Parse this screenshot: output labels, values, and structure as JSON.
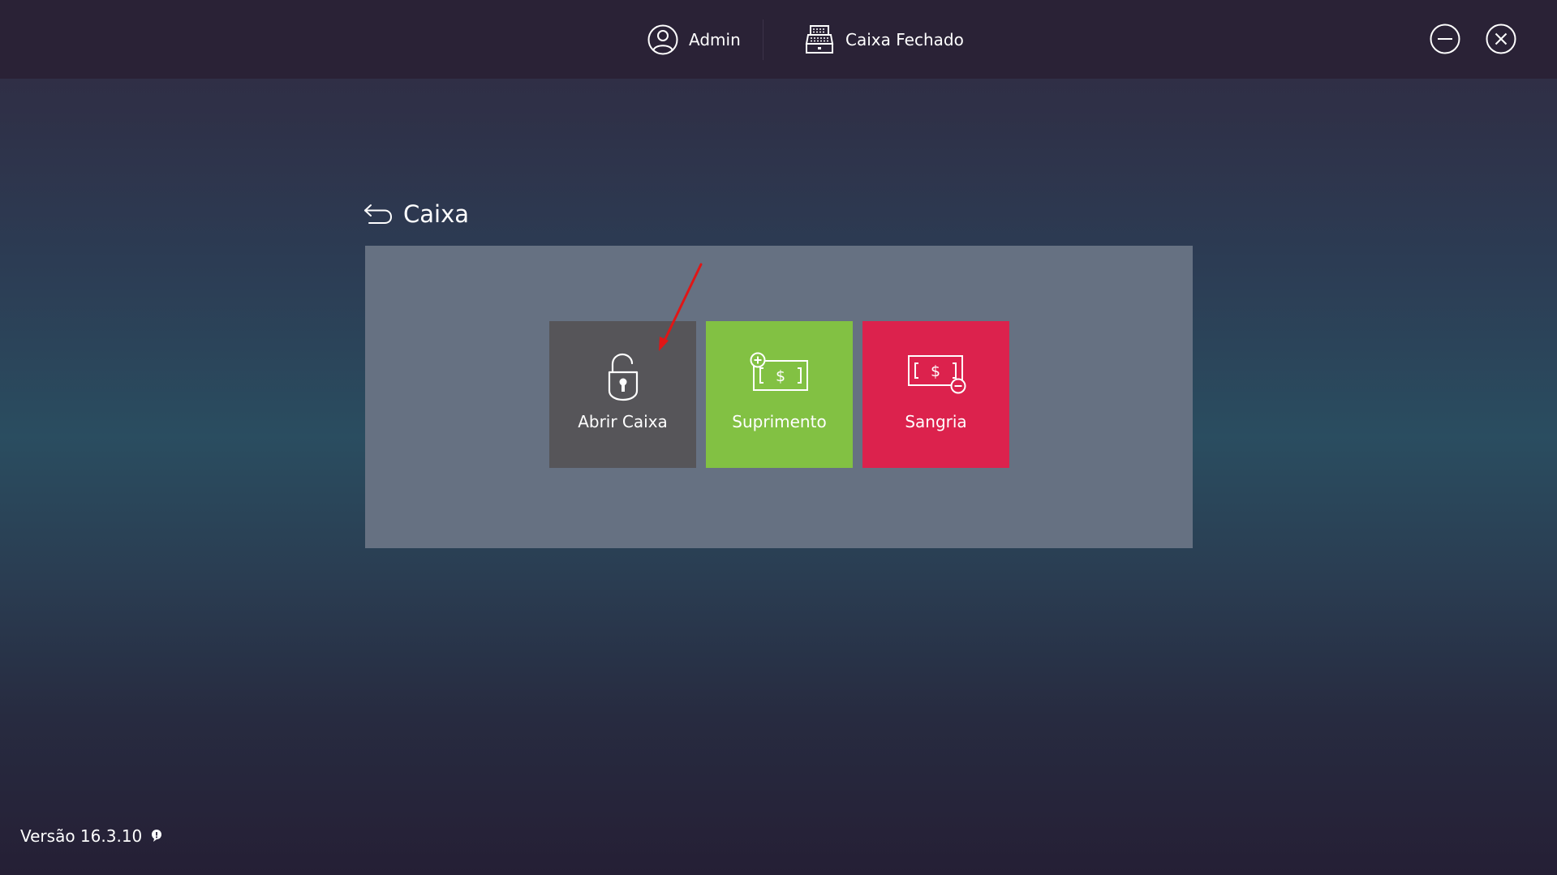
{
  "header": {
    "user_name": "Admin",
    "register_status": "Caixa Fechado",
    "icons": [
      "user-icon",
      "cash-register-icon",
      "minimize-icon",
      "close-icon"
    ]
  },
  "section": {
    "title": "Caixa",
    "back_icon": "back-arrow-icon"
  },
  "tiles": [
    {
      "label": "Abrir Caixa",
      "icon": "unlock-icon",
      "color": "#565559"
    },
    {
      "label": "Suprimento",
      "icon": "cash-add-icon",
      "color": "#82c143"
    },
    {
      "label": "Sangria",
      "icon": "cash-remove-icon",
      "color": "#dc224d"
    }
  ],
  "footer": {
    "version": "Versão 16.3.10",
    "icon": "info-icon"
  },
  "colors": {
    "topbar": "#2a2236",
    "panel": "#667182",
    "annotation_arrow": "#e01616"
  }
}
